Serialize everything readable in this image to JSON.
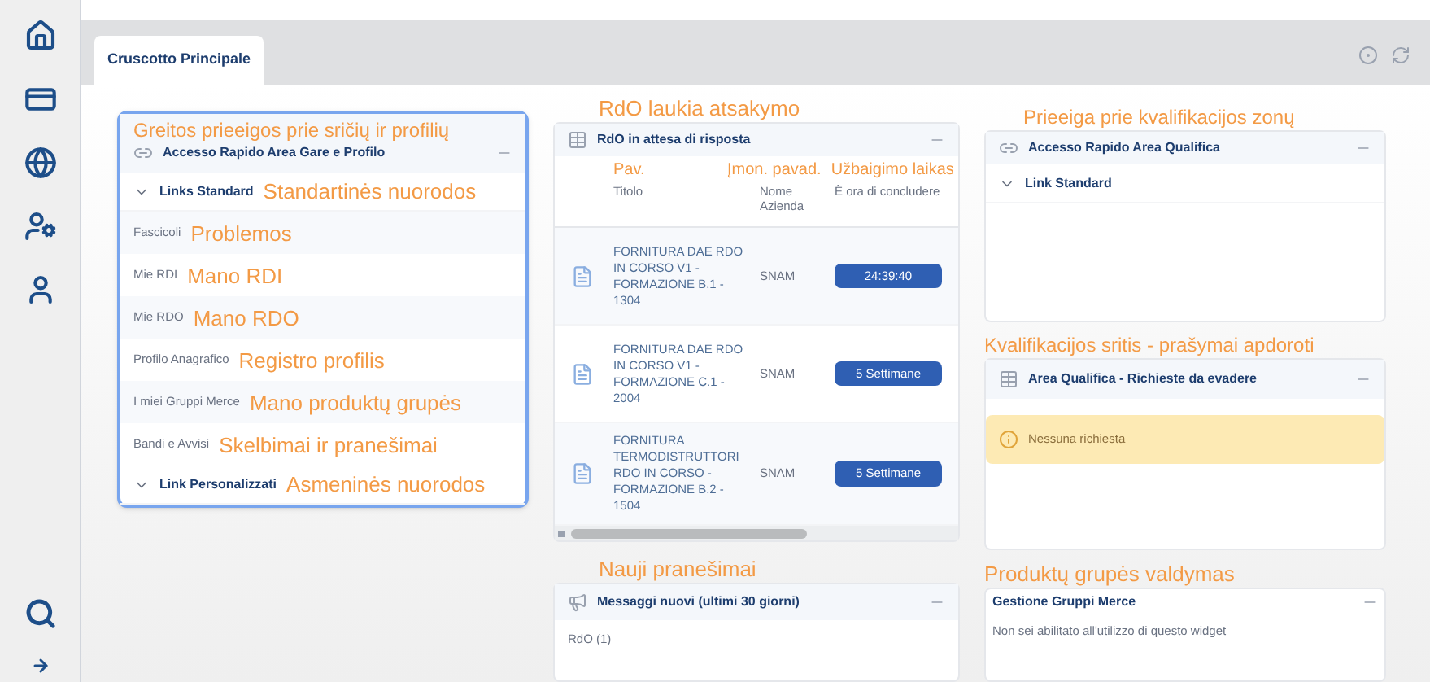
{
  "tabs": [
    {
      "label": "Cruscotto Principale",
      "selected": true
    }
  ],
  "left_widget": {
    "annotation": "Greitos prieeigos prie sričių ir profilių",
    "title": "Accesso Rapido Area Gare e Profilo",
    "highlighted": true,
    "sections": [
      {
        "label": "Links Standard",
        "annotation": "Standartinės nuorodos",
        "links": [
          {
            "label": "Fascicoli",
            "annotation": "Problemos"
          },
          {
            "label": "Mie RDI",
            "annotation": "Mano RDI"
          },
          {
            "label": "Mie RDO",
            "annotation": "Mano RDO"
          },
          {
            "label": "Profilo Anagrafico",
            "annotation": "Registro profilis"
          },
          {
            "label": "I miei Gruppi Merce",
            "annotation": "Mano produktų grupės"
          },
          {
            "label": "Bandi e Avvisi",
            "annotation": "Skelbimai ir pranešimai"
          }
        ]
      },
      {
        "label": "Link Personalizzati",
        "annotation": "Asmeninės nuorodos"
      }
    ]
  },
  "rdo_widget": {
    "annotation": "RdO laukia atsakymo",
    "title": "RdO in attesa di risposta",
    "columns": [
      {
        "label": "Titolo",
        "annotation": "Pav."
      },
      {
        "label": "Nome Azienda",
        "annotation": "Įmon. pavad."
      },
      {
        "label": "È ora di concludere",
        "annotation": "Užbaigimo laikas"
      }
    ],
    "rows": [
      {
        "title": "FORNITURA DAE RDO IN CORSO V1 - FORMAZIONE B.1 - 1304",
        "company": "SNAM",
        "deadline": "24:39:40"
      },
      {
        "title": "FORNITURA DAE RDO IN CORSO V1 - FORMAZIONE C.1 - 2004",
        "company": "SNAM",
        "deadline": "5 Settimane"
      },
      {
        "title": "FORNITURA TERMODISTRUTTORI RDO IN CORSO - FORMAZIONE B.2 - 1504",
        "company": "SNAM",
        "deadline": "5 Settimane"
      }
    ]
  },
  "messages_widget": {
    "annotation": "Nauji pranešimai",
    "title": "Messaggi nuovi (ultimi 30 giorni)",
    "items": [
      "RdO (1)"
    ]
  },
  "qualifica_widget": {
    "annotation": "Prieeiga prie kvalifikacijos zonų",
    "title": "Accesso Rapido Area Qualifica",
    "sections": [
      {
        "label": "Link Standard"
      }
    ]
  },
  "requests_widget": {
    "annotation": "Kvalifikacijos sritis - prašymai apdoroti",
    "title": "Area Qualifica - Richieste da evadere",
    "alert": "Nessuna richiesta"
  },
  "gruppi_widget": {
    "annotation": "Produktų grupės valdymas",
    "title": "Gestione Gruppi Merce",
    "message": "Non sei abilitato all'utilizzo di questo widget"
  }
}
